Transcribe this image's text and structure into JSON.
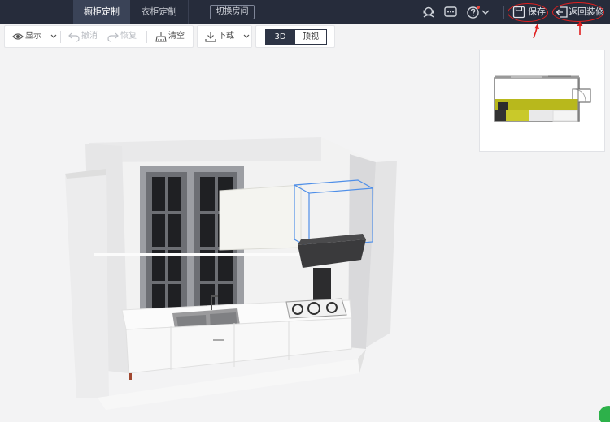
{
  "topbar": {
    "tabs": [
      {
        "label": "橱柜定制",
        "active": true
      },
      {
        "label": "衣柜定制",
        "active": false
      }
    ],
    "switch_room": "切换房间",
    "save_label": "保存",
    "back_label": "返回装修",
    "icons": [
      "user-support-icon",
      "message-icon",
      "help-icon",
      "chevron-down-icon",
      "save-icon",
      "back-icon"
    ]
  },
  "toolbar": {
    "display": "显示",
    "undo": "撤消",
    "redo": "恢复",
    "clear": "清空",
    "download": "下载",
    "view_3d": "3D",
    "view_top": "顶视"
  },
  "colors": {
    "topbar_bg": "#262c3b",
    "tab_active_bg": "#3a4357",
    "highlight_red": "#e02020",
    "cabinet_accent": "#b8b81c"
  }
}
